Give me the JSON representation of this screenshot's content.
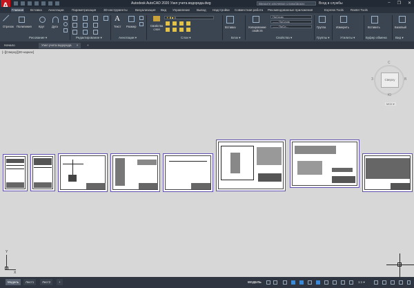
{
  "app": {
    "logo_letter": "A",
    "title": "Autodesk AutoCAD 2020   Узел учета водорода.dwg",
    "search_placeholder": "Введите ключевое слово/фразу",
    "signin": "Вход в службы",
    "window_buttons": [
      "–",
      "❐",
      "✕"
    ]
  },
  "ribbon_tabs": [
    "Главная",
    "Вставка",
    "Аннотации",
    "Параметризация",
    "3D-инструменты",
    "Визуализация",
    "Вид",
    "Управление",
    "Вывод",
    "Надстройки",
    "Совместная работа",
    "Рекомендованные приложения",
    "Express Tools",
    "Raster Tools"
  ],
  "active_ribbon_tab": "Главная",
  "ribbon": {
    "draw_tools": [
      "Отрезок",
      "Полилиния",
      "Круг",
      "Дуга"
    ],
    "draw_panel": "Рисование ▾",
    "modify_panel": "Редактирование ▾",
    "text_tool": "Текст",
    "dim_tool": "Размер",
    "annotation_panel": "Аннотации ▾",
    "layer_props": "Свойства слоя",
    "layers_panel": "Слои ▾",
    "insert_tool": "Вставка",
    "block_panel": "Блок ▾",
    "copy_props": "Копирование свойств",
    "prop_bylayer_1": "ПоСлою",
    "prop_bylayer_2": "—— ПоСлою",
    "prop_bylayer_3": "—— ПоСл...",
    "properties_panel": "Свойства ▾",
    "group_tool": "Группа",
    "groups_panel": "Группы ▾",
    "measure_tool": "Измерить",
    "utilities_panel": "Утилиты ▾",
    "paste_tool": "Вставить",
    "clipboard_panel": "Буфер обмена",
    "base_tool": "Базовый",
    "view_panel": "Вид ▾"
  },
  "doc_tabs": [
    "Начало",
    "Узел учета водорода"
  ],
  "active_doc_tab": "Узел учета водорода",
  "doc_tab_close": "×",
  "doc_tab_add": "+",
  "viewport_label": "[–][Сверху][2D-каркас]",
  "viewcube": {
    "north": "С",
    "south": "Ю",
    "west": "З",
    "east": "В",
    "face": "Сверху",
    "wcs": "МСК ▾"
  },
  "ucs": {
    "x": "X",
    "y": "Y"
  },
  "status": {
    "layout_tabs": [
      "Модель",
      "Лист1",
      "Лист2"
    ],
    "active_layout": "Модель",
    "add_tab": "+",
    "mode": "МОДЕЛЬ",
    "scale": "1:1 ▾"
  },
  "colors": {
    "titlebar": "#222a35",
    "ribbon": "#3b4451",
    "canvas": "#d7d7d7",
    "sheet_border": "#5e4fb3",
    "accent": "#3a8ad8"
  }
}
